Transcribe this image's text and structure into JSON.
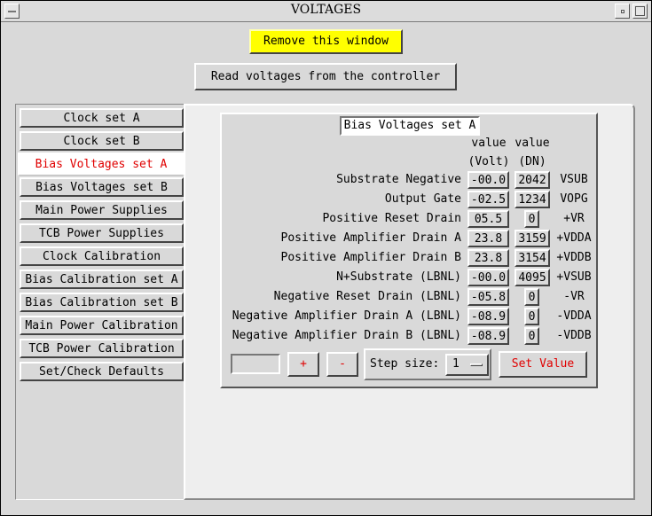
{
  "window": {
    "title": "VOLTAGES"
  },
  "top_buttons": {
    "remove": "Remove this window",
    "read": "Read voltages from the controller"
  },
  "tabs": [
    "Clock set A",
    "Clock set B",
    "Bias Voltages set A",
    "Bias Voltages set B",
    "Main Power Supplies",
    "TCB Power Supplies",
    "Clock Calibration",
    "Bias Calibration set A",
    "Bias Calibration set B",
    "Main Power Calibration",
    "TCB Power Calibration",
    "Set/Check Defaults"
  ],
  "active_tab": "Bias Voltages set A",
  "panel": {
    "title": "Bias Voltages set A",
    "headers": {
      "value1": "value",
      "unit1": "(Volt)",
      "value2": "value",
      "unit2": "(DN)"
    },
    "rows": [
      {
        "label": "Substrate Negative",
        "volt": "-00.0",
        "dn": "2042",
        "signal": "VSUB"
      },
      {
        "label": "Output Gate",
        "volt": "-02.5",
        "dn": "1234",
        "signal": "VOPG"
      },
      {
        "label": "Positive Reset Drain",
        "volt": "05.5",
        "dn": "0",
        "signal": "+VR"
      },
      {
        "label": "Positive Amplifier Drain A",
        "volt": "23.8",
        "dn": "3159",
        "signal": "+VDDA"
      },
      {
        "label": "Positive Amplifier Drain B",
        "volt": "23.8",
        "dn": "3154",
        "signal": "+VDDB"
      },
      {
        "label": "N+Substrate (LBNL)",
        "volt": "-00.0",
        "dn": "4095",
        "signal": "+VSUB"
      },
      {
        "label": "Negative Reset Drain (LBNL)",
        "volt": "-05.8",
        "dn": "0",
        "signal": "-VR"
      },
      {
        "label": "Negative Amplifier Drain A (LBNL)",
        "volt": "-08.9",
        "dn": "0",
        "signal": "-VDDA"
      },
      {
        "label": "Negative Amplifier Drain B (LBNL)",
        "volt": "-08.9",
        "dn": "0",
        "signal": "-VDDB"
      }
    ],
    "controls": {
      "entry_value": "",
      "plus": "+",
      "minus": "-",
      "step_label": "Step size:",
      "step_value": "1",
      "set_value": "Set Value"
    }
  },
  "colors": {
    "highlight_red": "#e00000",
    "remove_button": "#ffff00"
  }
}
